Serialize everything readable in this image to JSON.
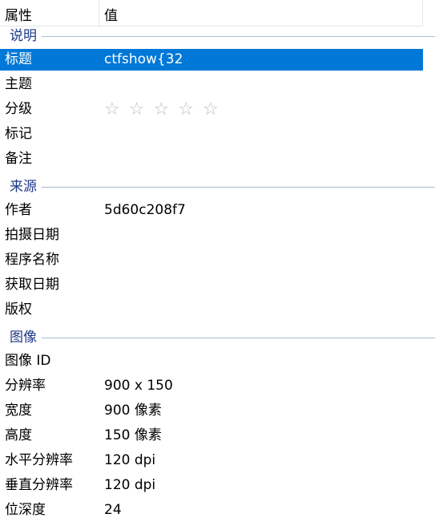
{
  "columns": {
    "property": "属性",
    "value": "值"
  },
  "groups": [
    {
      "title": "说明",
      "rows": [
        {
          "key": "标题",
          "value": "ctfshow{32",
          "selected": true
        },
        {
          "key": "主题",
          "value": ""
        },
        {
          "key": "分级",
          "value": "",
          "rating": 0,
          "rating_max": 5
        },
        {
          "key": "标记",
          "value": ""
        },
        {
          "key": "备注",
          "value": ""
        }
      ]
    },
    {
      "title": "来源",
      "rows": [
        {
          "key": "作者",
          "value": "5d60c208f7"
        },
        {
          "key": "拍摄日期",
          "value": ""
        },
        {
          "key": "程序名称",
          "value": ""
        },
        {
          "key": "获取日期",
          "value": ""
        },
        {
          "key": "版权",
          "value": ""
        }
      ]
    },
    {
      "title": "图像",
      "rows": [
        {
          "key": "图像 ID",
          "value": ""
        },
        {
          "key": "分辨率",
          "value": "900 x 150"
        },
        {
          "key": "宽度",
          "value": "900 像素"
        },
        {
          "key": "高度",
          "value": "150 像素"
        },
        {
          "key": "水平分辨率",
          "value": "120 dpi"
        },
        {
          "key": "垂直分辨率",
          "value": "120 dpi"
        },
        {
          "key": "位深度",
          "value": "24"
        }
      ]
    }
  ],
  "colors": {
    "selection": "#0078d7",
    "group_title": "#1e3a8a",
    "group_line": "#a9bcd6",
    "star": "#bdbdbd"
  }
}
